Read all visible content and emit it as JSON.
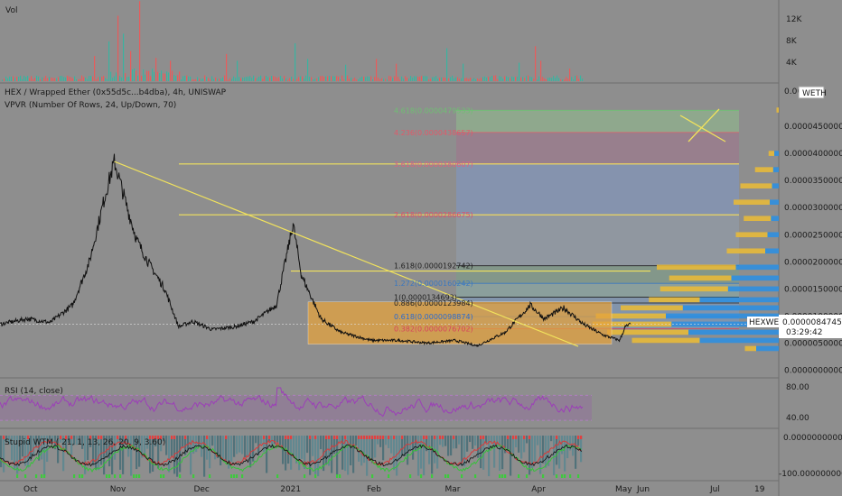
{
  "panes": {
    "volume": {
      "label": "Vol",
      "ticks": [
        "12K",
        "8K",
        "4K"
      ]
    },
    "price": {
      "symbol": "HEX / Wrapped Ether (0x55d5c...b4dba), 4h, UNISWAP",
      "vpvr": "VPVR (Number Of Rows, 24, Up/Down, 70)",
      "currency": "WETH",
      "last_price_symbol": "HEXWETH",
      "last_price": "0.0000084745",
      "countdown": "03:29:42"
    },
    "rsi": {
      "label": "RSI (14, close)",
      "ticks": [
        "80.00",
        "40.00"
      ]
    },
    "stupid": {
      "label": "Stupid WTM ( 21, 1, 13, 26, 20, 9, 3.60)",
      "ticks": [
        "0.0000000000",
        "-100.0000000000"
      ]
    }
  },
  "price_axis": [
    "0.000",
    "0.0000450000",
    "0.0000400000",
    "0.0000350000",
    "0.0000300000",
    "0.0000250000",
    "0.0000200000",
    "0.0000150000",
    "0.0000100000",
    "0.0000050000",
    "0.0000000000"
  ],
  "time_axis": [
    "Oct",
    "Nov",
    "Dec",
    "2021",
    "Feb",
    "Mar",
    "Apr",
    "May",
    "Jun",
    "Jul",
    "19"
  ],
  "colors": {
    "background": "#8e8e8e",
    "price_line": "#111111",
    "trendline": "#f2e35c",
    "box": "#e3a23e",
    "rsi": "#9c3fb8",
    "vp_up": "#2f8fe0",
    "vp_down": "#e7b93a"
  },
  "chart_data": [
    {
      "type": "line",
      "title": "HEX / Wrapped Ether (0x55d5c...b4dba), 4h, UNISWAP",
      "x_range": [
        "2020-09-20",
        "2021-06-26"
      ],
      "ylim": [
        0,
        5.15e-05
      ],
      "series": [
        {
          "name": "HEX / Wrapped Ether (0x55d5c...b4dba), 4h, UNISWAP",
          "points": [
            [
              "2020-09-20",
              8.5e-06
            ],
            [
              "2020-09-30",
              9.5e-06
            ],
            [
              "2020-10-08",
              8.8e-06
            ],
            [
              "2020-10-16",
              1.2e-05
            ],
            [
              "2020-10-22",
              2e-05
            ],
            [
              "2020-10-28",
              3.3e-05
            ],
            [
              "2020-10-31",
              3.85e-05
            ],
            [
              "2020-11-04",
              3.1e-05
            ],
            [
              "2020-11-08",
              2.4e-05
            ],
            [
              "2020-11-12",
              2e-05
            ],
            [
              "2020-11-18",
              1.5e-05
            ],
            [
              "2020-11-23",
              8e-06
            ],
            [
              "2020-11-28",
              9e-06
            ],
            [
              "2020-12-05",
              7.5e-06
            ],
            [
              "2020-12-13",
              8e-06
            ],
            [
              "2020-12-20",
              9e-06
            ],
            [
              "2020-12-28",
              1.2e-05
            ],
            [
              "2021-01-03",
              2.7e-05
            ],
            [
              "2021-01-06",
              1.75e-05
            ],
            [
              "2021-01-13",
              9.5e-06
            ],
            [
              "2021-01-20",
              7e-06
            ],
            [
              "2021-01-31",
              5.5e-06
            ],
            [
              "2021-02-10",
              5.5e-06
            ],
            [
              "2021-02-20",
              5e-06
            ],
            [
              "2021-03-02",
              5.5e-06
            ],
            [
              "2021-03-10",
              4.5e-06
            ],
            [
              "2021-03-20",
              7e-06
            ],
            [
              "2021-03-29",
              1.2e-05
            ],
            [
              "2021-04-03",
              9.5e-06
            ],
            [
              "2021-04-10",
              1.15e-05
            ],
            [
              "2021-04-17",
              8.5e-06
            ],
            [
              "2021-04-24",
              6.5e-06
            ],
            [
              "2021-04-30",
              5.5e-06
            ],
            [
              "2021-05-02",
              8e-06
            ],
            [
              "2021-05-04",
              8.5e-06
            ]
          ]
        }
      ],
      "fib_levels": [
        {
          "label": "4.618(0.0000479533)",
          "value": 4.79533e-05
        },
        {
          "label": "4.236(0.0000438657)",
          "value": 4.38657e-05
        },
        {
          "label": "3.618(0.0000380607)",
          "value": 3.80607e-05
        },
        {
          "label": "2.618(0.0000286675)",
          "value": 2.86675e-05
        },
        {
          "label": "1.618(0.0000192742)",
          "value": 1.92742e-05
        },
        {
          "label": "1.272(0.0000160242)",
          "value": 1.60242e-05
        },
        {
          "label": "1(0.0000134693)",
          "value": 1.34693e-05
        },
        {
          "label": "0.886(0.0000123984)",
          "value": 1.23984e-05
        },
        {
          "label": "0.618(0.0000098874)",
          "value": 9.8874e-06
        },
        {
          "label": "0.382(0.0000076702)",
          "value": 7.6702e-06
        }
      ],
      "volume_profile": [
        {
          "price": 4.8e-05,
          "up": 0.0,
          "down": 0.02
        },
        {
          "price": 4.5e-05,
          "up": 0.0,
          "down": 0.0
        },
        {
          "price": 4e-05,
          "up": 0.04,
          "down": 0.05
        },
        {
          "price": 3.7e-05,
          "up": 0.05,
          "down": 0.16
        },
        {
          "price": 3.4e-05,
          "up": 0.06,
          "down": 0.28
        },
        {
          "price": 3.1e-05,
          "up": 0.08,
          "down": 0.32
        },
        {
          "price": 2.8e-05,
          "up": 0.07,
          "down": 0.24
        },
        {
          "price": 2.5e-05,
          "up": 0.1,
          "down": 0.28
        },
        {
          "price": 2.2e-05,
          "up": 0.12,
          "down": 0.34
        },
        {
          "price": 1.9e-05,
          "up": 0.38,
          "down": 0.7
        },
        {
          "price": 1.7e-05,
          "up": 0.42,
          "down": 0.55
        },
        {
          "price": 1.5e-05,
          "up": 0.45,
          "down": 0.6
        },
        {
          "price": 1.3e-05,
          "up": 0.7,
          "down": 0.45
        },
        {
          "price": 1.15e-05,
          "up": 0.85,
          "down": 0.55
        },
        {
          "price": 1e-05,
          "up": 1.0,
          "down": 0.62
        },
        {
          "price": 8.5e-06,
          "up": 0.95,
          "down": 0.7
        },
        {
          "price": 7e-06,
          "up": 0.8,
          "down": 0.72
        },
        {
          "price": 5.5e-06,
          "up": 0.7,
          "down": 0.6
        },
        {
          "price": 4e-06,
          "up": 0.2,
          "down": 0.1
        }
      ]
    },
    {
      "type": "bar",
      "title": "Vol",
      "ylim": [
        0,
        16000
      ],
      "spikes": [
        [
          "2020-10-24",
          5200
        ],
        [
          "2020-10-29",
          8200
        ],
        [
          "2020-11-01",
          13500
        ],
        [
          "2020-11-03",
          9800
        ],
        [
          "2020-11-06",
          6200
        ],
        [
          "2020-11-09",
          16500
        ],
        [
          "2020-11-15",
          4800
        ],
        [
          "2020-11-20",
          4200
        ],
        [
          "2020-12-10",
          5600
        ],
        [
          "2020-12-14",
          4200
        ],
        [
          "2021-01-04",
          7800
        ],
        [
          "2021-01-08",
          4600
        ],
        [
          "2021-01-22",
          3400
        ],
        [
          "2021-02-02",
          4600
        ],
        [
          "2021-02-09",
          3600
        ],
        [
          "2021-02-27",
          6800
        ],
        [
          "2021-03-05",
          3600
        ],
        [
          "2021-03-25",
          3800
        ],
        [
          "2021-03-31",
          7200
        ],
        [
          "2021-04-02",
          4200
        ],
        [
          "2021-04-12",
          2600
        ],
        [
          "2021-05-01",
          1900
        ]
      ]
    },
    {
      "type": "line",
      "title": "RSI (14, close)",
      "ylim": [
        20,
        95
      ],
      "levels": [
        70,
        30
      ],
      "series": [
        {
          "name": "RSI (14, close)",
          "base": 55
        }
      ]
    }
  ]
}
